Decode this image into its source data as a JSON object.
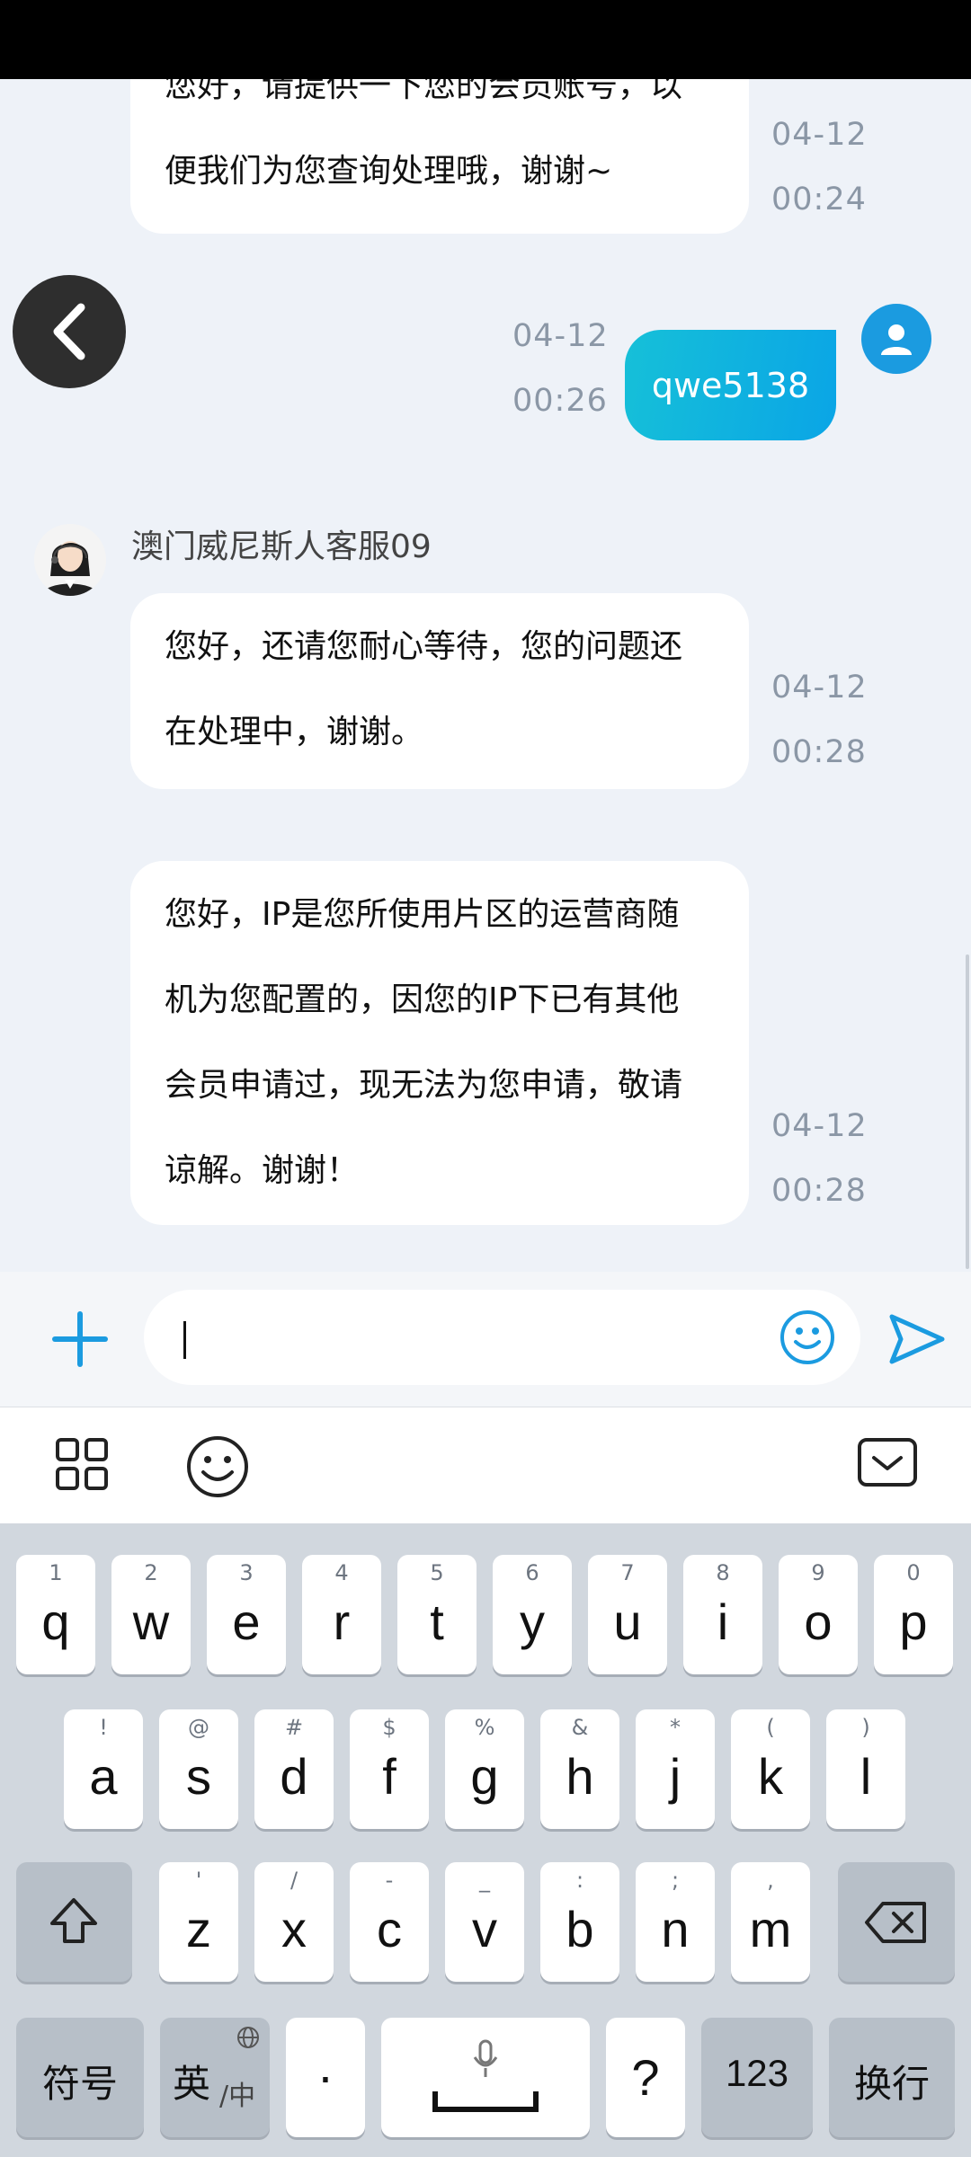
{
  "chat": {
    "messages": [
      {
        "sender": "agent",
        "lines": [
          "您好，请提供一下您的会员账号，以",
          "便我们为您查询处理哦，谢谢~"
        ],
        "date": "04-12",
        "time": "00:24"
      },
      {
        "sender": "user",
        "text": "qwe5138",
        "date": "04-12",
        "time": "00:26"
      },
      {
        "sender": "agent",
        "name": "澳门威尼斯人客服09",
        "lines": [
          "您好，还请您耐心等待，您的问题还",
          "在处理中，谢谢。"
        ],
        "date": "04-12",
        "time": "00:28"
      },
      {
        "sender": "agent",
        "lines": [
          "您好，IP是您所使用片区的运营商随",
          "机为您配置的，因您的IP下已有其他",
          "会员申请过，现无法为您申请，敬请",
          "谅解。谢谢！"
        ],
        "date": "04-12",
        "time": "00:28"
      }
    ]
  },
  "input": {
    "value": ""
  },
  "colors": {
    "accent": "#1b9be0",
    "bubble_user_start": "#16c0d8",
    "bubble_user_end": "#0aa5e6"
  },
  "keyboard": {
    "row1": [
      {
        "hint": "1",
        "key": "q"
      },
      {
        "hint": "2",
        "key": "w"
      },
      {
        "hint": "3",
        "key": "e"
      },
      {
        "hint": "4",
        "key": "r"
      },
      {
        "hint": "5",
        "key": "t"
      },
      {
        "hint": "6",
        "key": "y"
      },
      {
        "hint": "7",
        "key": "u"
      },
      {
        "hint": "8",
        "key": "i"
      },
      {
        "hint": "9",
        "key": "o"
      },
      {
        "hint": "0",
        "key": "p"
      }
    ],
    "row2": [
      {
        "hint": "!",
        "key": "a"
      },
      {
        "hint": "@",
        "key": "s"
      },
      {
        "hint": "#",
        "key": "d"
      },
      {
        "hint": "$",
        "key": "f"
      },
      {
        "hint": "%",
        "key": "g"
      },
      {
        "hint": "&",
        "key": "h"
      },
      {
        "hint": "*",
        "key": "j"
      },
      {
        "hint": "(",
        "key": "k"
      },
      {
        "hint": ")",
        "key": "l"
      }
    ],
    "row3": [
      {
        "hint": "'",
        "key": "z"
      },
      {
        "hint": "/",
        "key": "x"
      },
      {
        "hint": "-",
        "key": "c"
      },
      {
        "hint": "_",
        "key": "v"
      },
      {
        "hint": ":",
        "key": "b"
      },
      {
        "hint": ";",
        "key": "n"
      },
      {
        "hint": ",",
        "key": "m"
      }
    ],
    "symbols_label": "符号",
    "lang_label": "英",
    "lang_sub": "/中",
    "dot_label": "·",
    "question_label": "?",
    "numbers_label": "123",
    "enter_label": "换行"
  }
}
